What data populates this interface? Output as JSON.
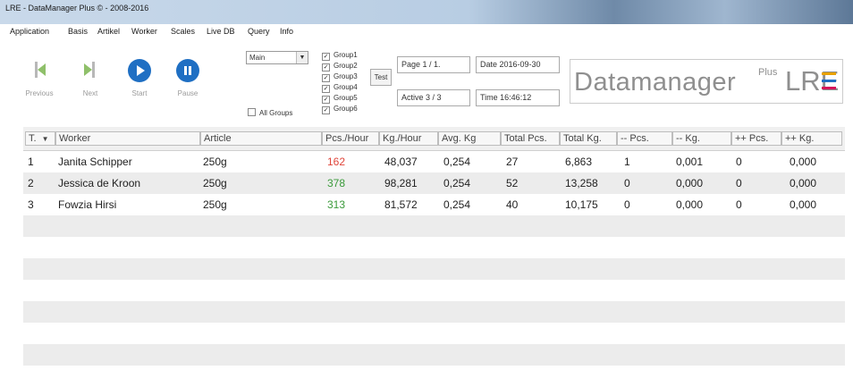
{
  "window": {
    "title": "LRE - DataManager Plus © - 2008-2016"
  },
  "menu": [
    "Application",
    "Basis",
    "Artikel",
    "Worker",
    "Scales",
    "Live DB",
    "Query",
    "Info"
  ],
  "toolbar": {
    "previous": "Previous",
    "next": "Next",
    "start": "Start",
    "pause": "Pause",
    "view_select": "Main",
    "all_groups": "All Groups",
    "groups": [
      "Group1",
      "Group2",
      "Group3",
      "Group4",
      "Group5",
      "Group6"
    ],
    "test_button": "Test",
    "page": "Page 1 / 1.",
    "active": "Active 3 / 3",
    "date": "Date 2016-09-30",
    "time": "Time 16:46:12"
  },
  "logo": {
    "main": "Datamanager",
    "sup": "Plus",
    "brand": "LRE",
    "bar_colors": [
      "#e8a100",
      "#1f6fc3",
      "#d4145a"
    ]
  },
  "colors": {
    "accent": "#1f6fc3",
    "low_rate": "#e0453a",
    "high_rate": "#3a9a3a"
  },
  "table": {
    "columns": [
      "T.",
      "Worker",
      "Article",
      "Pcs./Hour",
      "Kg./Hour",
      "Avg. Kg",
      "Total Pcs.",
      "Total Kg.",
      "-- Pcs.",
      "-- Kg.",
      "++ Pcs.",
      "++ Kg."
    ],
    "rows": [
      [
        "1",
        "Janita Schipper",
        "250g",
        "162",
        "48,037",
        "0,254",
        "27",
        "6,863",
        "1",
        "0,001",
        "0",
        "0,000"
      ],
      [
        "2",
        "Jessica de Kroon",
        "250g",
        "378",
        "98,281",
        "0,254",
        "52",
        "13,258",
        "0",
        "0,000",
        "0",
        "0,000"
      ],
      [
        "3",
        "Fowzia Hirsi",
        "250g",
        "313",
        "81,572",
        "0,254",
        "40",
        "10,175",
        "0",
        "0,000",
        "0",
        "0,000"
      ]
    ]
  }
}
